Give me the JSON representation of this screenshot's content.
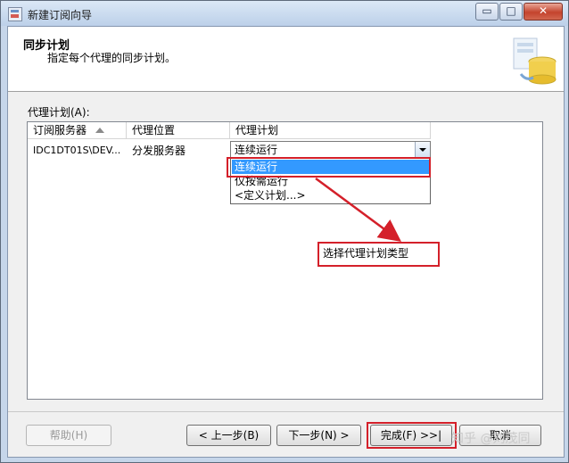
{
  "window": {
    "title": "新建订阅向导",
    "controls": {
      "minimize": "▭",
      "maximize": "□",
      "close": "✕"
    }
  },
  "header": {
    "title": "同步计划",
    "subtitle": "指定每个代理的同步计划。",
    "icon": "database-sync-icon"
  },
  "agents": {
    "label": "代理计划(A):",
    "columns": [
      "订阅服务器",
      "代理位置",
      "代理计划"
    ],
    "rows": [
      {
        "subscriber": "IDC1DT01S\\DEV...",
        "location": "分发服务器",
        "schedule": "连续运行"
      }
    ],
    "dropdown_options": [
      "连续运行",
      "仅按需运行",
      "<定义计划...>"
    ],
    "selected_option_index": 0
  },
  "annotation": {
    "callout_text": "选择代理计划类型",
    "highlight_color": "#d4202a"
  },
  "footer": {
    "help": "帮助(H)",
    "back": "< 上一步(B)",
    "next": "下一步(N) >",
    "finish": "完成(F) >>|",
    "cancel": "取消"
  },
  "watermark": "知乎 @刘茂同"
}
